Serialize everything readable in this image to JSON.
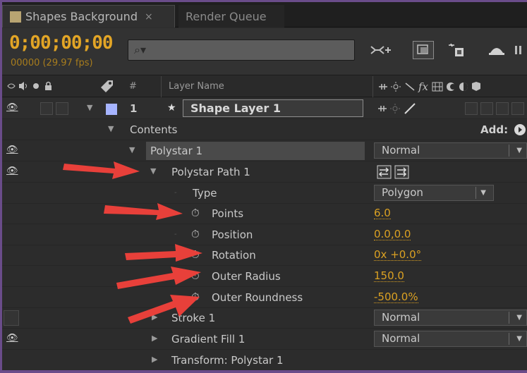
{
  "tabs": [
    {
      "label": "Shapes Background",
      "close": "×",
      "swatch_color": "#b8a472"
    },
    {
      "label": "Render Queue"
    }
  ],
  "toolbar": {
    "timecode": "0;00;00;00",
    "fps": "00000 (29.97 fps)",
    "search_placeholder": "⌕▾"
  },
  "column_header": {
    "hash": "#",
    "layer_name": "Layer Name"
  },
  "layer": {
    "number": "1",
    "name": "Shape Layer 1",
    "label_color": "#a6b4ff",
    "star": "★"
  },
  "tree": {
    "contents": "Contents",
    "add_label": "Add:",
    "polystar": "Polystar 1",
    "polystar_mode": "Normal",
    "polystar_path": "Polystar Path 1",
    "type_label": "Type",
    "type_value": "Polygon",
    "points_label": "Points",
    "points_value": "6.0",
    "position_label": "Position",
    "position_value": "0.0,0.0",
    "rotation_label": "Rotation",
    "rotation_value": "0x +0.0°",
    "outer_radius_label": "Outer Radius",
    "outer_radius_value": "150.0",
    "outer_roundness_label": "Outer Roundness",
    "outer_roundness_value": "-500.0%",
    "stroke": "Stroke 1",
    "stroke_mode": "Normal",
    "gradient_fill": "Gradient Fill 1",
    "gradient_mode": "Normal",
    "transform": "Transform: Polystar 1"
  },
  "colors": {
    "accent": "#dba122",
    "arrow": "#e8403a",
    "frame_border": "#6a4c8a"
  }
}
